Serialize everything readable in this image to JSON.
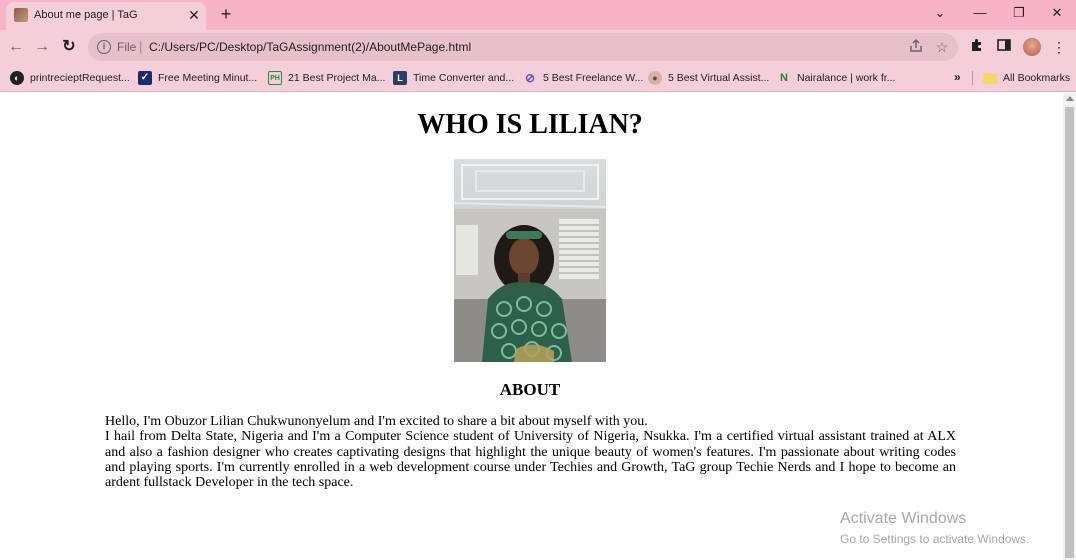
{
  "tab": {
    "title": "About me page | TaG",
    "close_glyph": "✕",
    "new_tab_glyph": "+"
  },
  "window_controls": {
    "tab_search": "⌄",
    "minimize": "—",
    "restore": "❐",
    "close": "✕"
  },
  "toolbar": {
    "back": "←",
    "forward": "→",
    "reload": "↻",
    "file_label": "File",
    "separator": "|",
    "url": "C:/Users/PC/Desktop/TaGAssignment(2)/AboutMePage.html"
  },
  "bookmarks": {
    "items": [
      {
        "label": "printrecieptRequest...",
        "icon": "globe-icon"
      },
      {
        "label": "Free Meeting Minut...",
        "icon": "checkmark-icon"
      },
      {
        "label": "21 Best Project Ma...",
        "icon": "ph-icon"
      },
      {
        "label": "Time Converter and...",
        "icon": "l-icon"
      },
      {
        "label": "5 Best Freelance W...",
        "icon": "orbit-icon"
      },
      {
        "label": "5 Best Virtual Assist...",
        "icon": "person-icon"
      },
      {
        "label": "Nairalance | work fr...",
        "icon": "n-icon"
      }
    ],
    "overflow": "»",
    "all_bookmarks": "All Bookmarks"
  },
  "page": {
    "title": "WHO IS LILIAN?",
    "about_heading": "ABOUT",
    "intro": "Hello, I'm Obuzor Lilian Chukwunonyelum and I'm excited to share a bit about myself with you.",
    "body": "I hail from Delta State, Nigeria and I'm a Computer Science student of University of Nigeria, Nsukka. I'm a certified virtual assistant trained at ALX and also a fashion designer who creates captivating designs that highlight the unique beauty of women's features. I'm passionate about writing codes and playing sports. I'm currently enrolled in a web development course under Techies and Growth, TaG group Techie Nerds and I hope to become an ardent fullstack Developer in the tech space."
  },
  "watermark": {
    "title": "Activate Windows",
    "subtitle": "Go to Settings to activate Windows."
  }
}
